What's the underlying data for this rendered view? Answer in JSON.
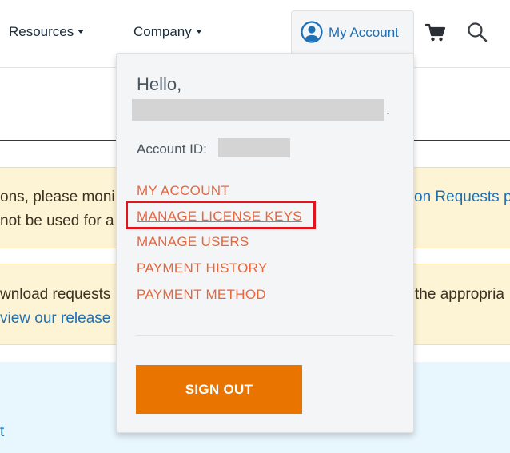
{
  "nav": {
    "resources_label": "Resources",
    "company_label": "Company",
    "account_label": "My Account",
    "avatar_icon": "user-circle-icon",
    "cart_icon": "cart-icon",
    "search_icon": "search-icon",
    "accent_color": "#1f6fb5"
  },
  "background": {
    "notice1_line1_left": "ons, please moni",
    "notice1_line1_right": "on Requests pa",
    "notice1_line2_left": "not be used for a",
    "notice2_line1_left": "wnload requests",
    "notice2_line1_right": "the appropria",
    "notice2_line2_left": "view our release",
    "info_fragment": "t"
  },
  "dropdown": {
    "greeting": "Hello,",
    "name_trailing": ".",
    "account_id_label": "Account ID:",
    "menu": [
      {
        "label": "MY ACCOUNT"
      },
      {
        "label": "MANAGE LICENSE KEYS"
      },
      {
        "label": "MANAGE USERS"
      },
      {
        "label": "PAYMENT HISTORY"
      },
      {
        "label": "PAYMENT METHOD"
      }
    ],
    "sign_out_label": "SIGN OUT",
    "link_color": "#e8663d",
    "button_color": "#ea7400",
    "highlight_color": "#e5131c"
  }
}
